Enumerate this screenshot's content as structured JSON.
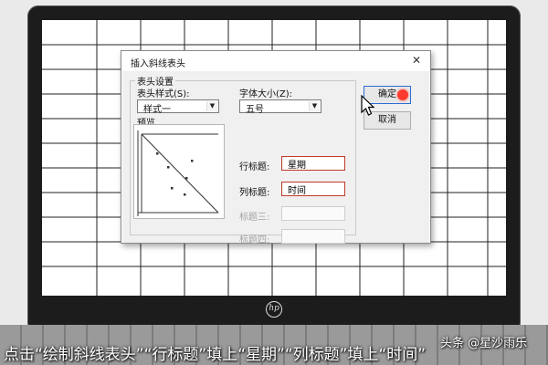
{
  "dialog": {
    "title": "插入斜线表头",
    "group_title": "表头设置",
    "style_label": "表头样式(S):",
    "style_value": "样式一",
    "font_size_label": "字体大小(Z):",
    "font_size_value": "五号",
    "preview_label": "预览",
    "row_title_label": "行标题:",
    "row_title_value": "星期",
    "col_title_label": "列标题:",
    "col_title_value": "时间",
    "title3_label": "标题三:",
    "title3_value": "",
    "title4_label": "标题四:",
    "title4_value": "",
    "ok_label": "确定",
    "cancel_label": "取消",
    "close_glyph": "✕",
    "dropdown_glyph": "▼"
  },
  "caption": "点击“绘制斜线表头”“行标题”填上“星期”“列标题”填上“时间”",
  "watermark": "头条 @星沙雨乐",
  "colors": {
    "highlight": "#c0392b",
    "default_button": "#2b6cd4",
    "click_indicator": "#ff3b30"
  }
}
